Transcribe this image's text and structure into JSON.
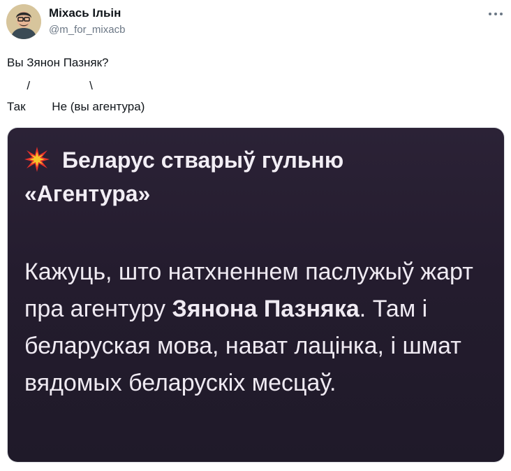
{
  "author": {
    "name": "Міхась Ільін",
    "handle": "@m_for_mixacb"
  },
  "tweet": {
    "line1": "Вы Зянон Пазняк?",
    "line2": "      /                  \\",
    "line3": "Так        Не (вы агентура)"
  },
  "card": {
    "title_line1": "Беларус стварыў гульню",
    "title_line2": "«Агентура»",
    "body_part1": "Кажуць, што натхненнем паслужыў жарт пра агентуру ",
    "body_bold": "Зянона Пазняка",
    "body_part2": ". Там і беларуская мова, нават лацінка, і шмат вядомых беларускіх месцаў."
  },
  "icons": {
    "more": "more-horizontal-icon",
    "title": "collision-icon"
  },
  "colors": {
    "card_background": "#241c2e",
    "card_text": "#efeaf2",
    "handle_text": "#6b7785",
    "explosion_red": "#e8322b",
    "explosion_yellow": "#f7c52b"
  }
}
